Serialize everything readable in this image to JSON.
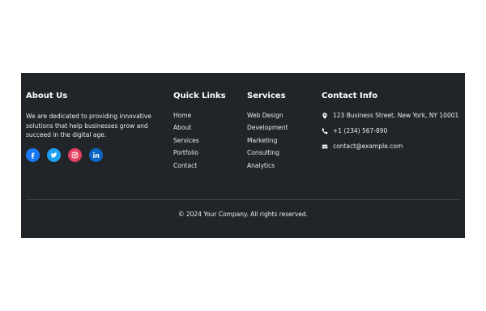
{
  "about": {
    "heading": "About Us",
    "text": "We are dedicated to providing innovative solutions that help businesses grow and succeed in the digital age.",
    "social": [
      {
        "icon": "facebook-icon",
        "color": "#1877f2"
      },
      {
        "icon": "twitter-icon",
        "color": "#1da1f2"
      },
      {
        "icon": "instagram-icon",
        "color": "#e4405f"
      },
      {
        "icon": "linkedin-icon",
        "color": "#0a66c2"
      }
    ]
  },
  "quick_links": {
    "heading": "Quick Links",
    "items": [
      "Home",
      "About",
      "Services",
      "Portfolio",
      "Contact"
    ]
  },
  "services": {
    "heading": "Services",
    "items": [
      "Web Design",
      "Development",
      "Marketing",
      "Consulting",
      "Analytics"
    ]
  },
  "contact": {
    "heading": "Contact Info",
    "address": "123 Business Street, New York, NY 10001",
    "phone": "+1 (234) 567-890",
    "email": "contact@example.com",
    "icons": [
      "map-marker-icon",
      "phone-icon",
      "envelope-icon"
    ]
  },
  "copyright": "© 2024 Your Company. All rights reserved.",
  "colors": {
    "footer_bg": "#212529",
    "divider": "#3d4248",
    "text": "#e9ecef"
  }
}
